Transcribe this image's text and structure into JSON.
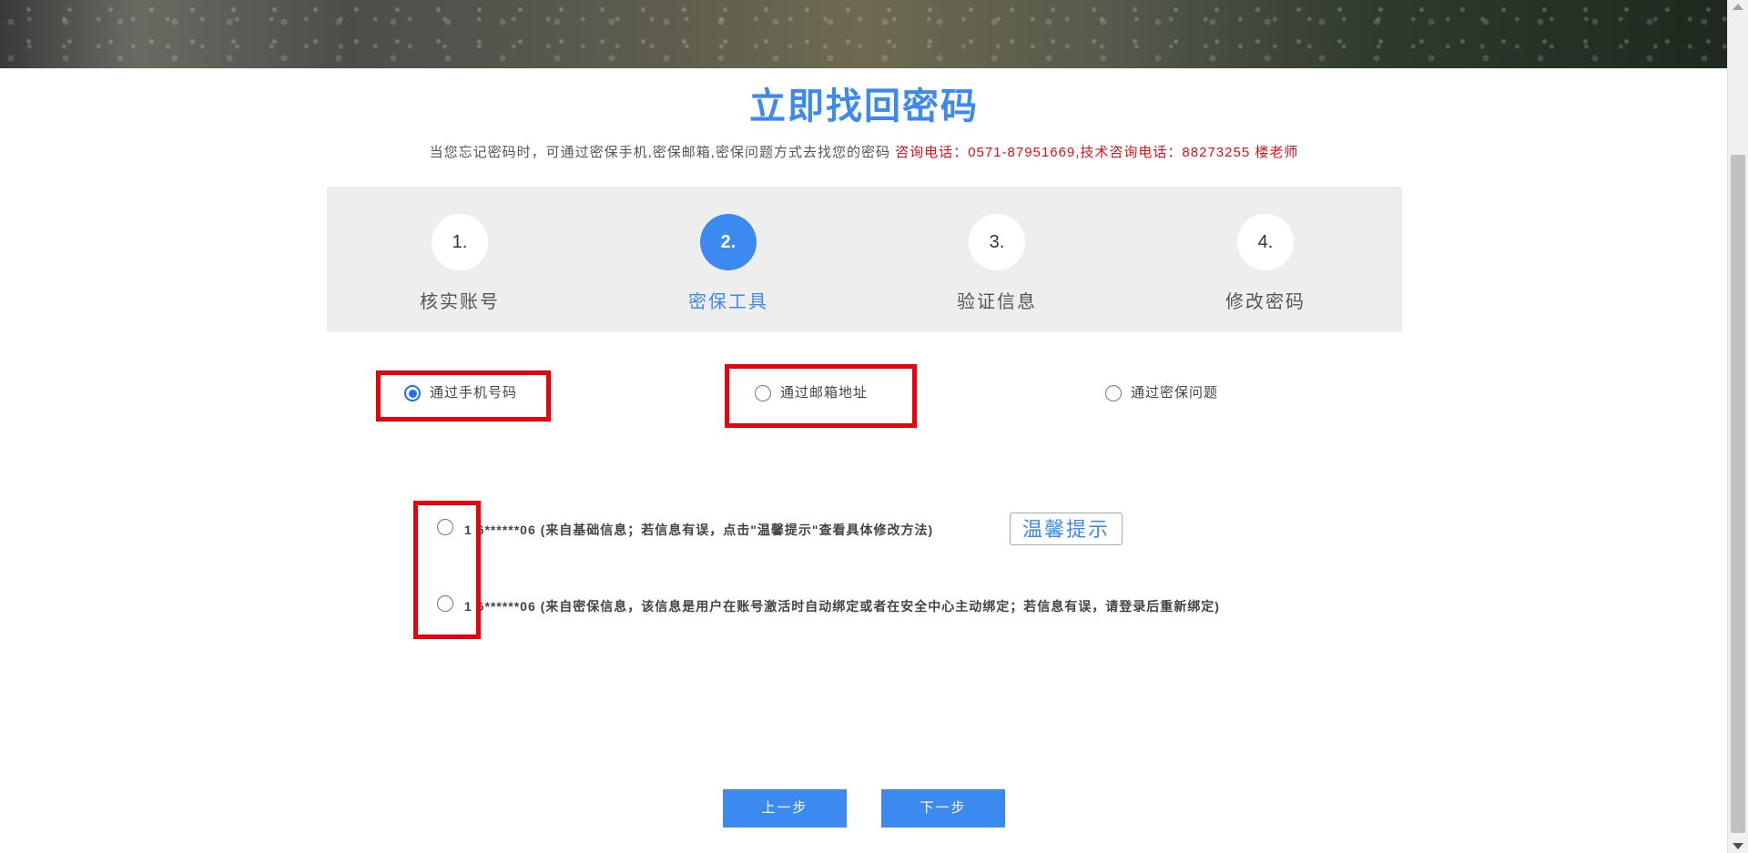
{
  "page": {
    "title": "立即找回密码",
    "subtitle_main": "当您忘记密码时，可通过密保手机,密保邮箱,密保问题方式去找您的密码",
    "subtitle_contact": " 咨询电话：0571-87951669,技术咨询电话：88273255 楼老师"
  },
  "steps": [
    {
      "num": "1.",
      "label": "核实账号"
    },
    {
      "num": "2.",
      "label": "密保工具"
    },
    {
      "num": "3.",
      "label": "验证信息"
    },
    {
      "num": "4.",
      "label": "修改密码"
    }
  ],
  "methods": {
    "phone": "通过手机号码",
    "email": "通过邮箱地址",
    "question": "通过密保问题"
  },
  "phones": [
    {
      "text": "1 6******06 (来自基础信息；若信息有误，点击\"温馨提示\"查看具体修改方法)"
    },
    {
      "text": "1 6******06 (来自密保信息，该信息是用户在账号激活时自动绑定或者在安全中心主动绑定；若信息有误，请登录后重新绑定)"
    }
  ],
  "tip_button": "温馨提示",
  "buttons": {
    "prev": "上一步",
    "next": "下一步"
  },
  "colors": {
    "accent": "#3c8af0",
    "highlight": "#e8000a",
    "contact": "#e0101a"
  }
}
